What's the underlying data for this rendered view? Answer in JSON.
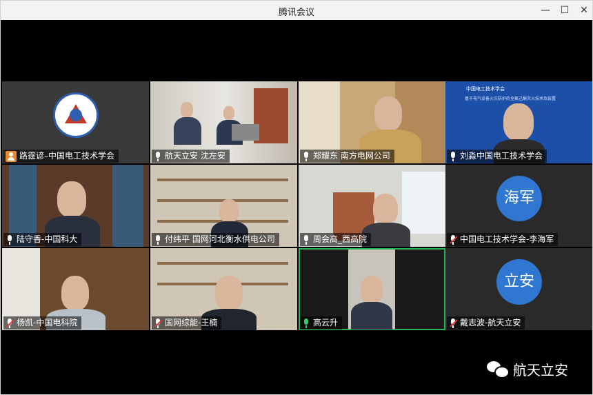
{
  "window": {
    "title": "腾讯会议",
    "min_icon": "minimize-icon",
    "max_icon": "maximize-icon",
    "close_icon": "close-icon"
  },
  "participants": [
    {
      "name": "路霆谚–中国电工技术学会",
      "mic": "user-badge"
    },
    {
      "name": "航天立安 沈左安",
      "mic": "on"
    },
    {
      "name": "郑耀东 南方电网公司",
      "mic": "on"
    },
    {
      "name": "刘淼中国电工技术学会",
      "mic": "on"
    },
    {
      "name": "陆守香-中国科大",
      "mic": "on"
    },
    {
      "name": "付纬平  国网河北衡水供电公司",
      "mic": "on"
    },
    {
      "name": "周会高_西高院",
      "mic": "on"
    },
    {
      "name": "中国电工技术学会-李海军",
      "mic": "muted",
      "avatar_text": "海军"
    },
    {
      "name": "杨凯-中国电科院",
      "mic": "muted"
    },
    {
      "name": "国网综能-王楠",
      "mic": "muted"
    },
    {
      "name": "高云升",
      "mic": "speaking"
    },
    {
      "name": "戴志波-航天立安",
      "mic": "muted",
      "avatar_text": "立安"
    }
  ],
  "slide": {
    "org": "中国电工技术学会",
    "headline": "基于电气设备火灾防护的全氟己酮灭火技术及装置"
  },
  "watermark": {
    "text": "航天立安",
    "icon": "wechat-icon"
  },
  "colors": {
    "avatar_blue": "#2f77d1",
    "active_border": "#2fb35a",
    "muted_red": "#e03a3a"
  }
}
